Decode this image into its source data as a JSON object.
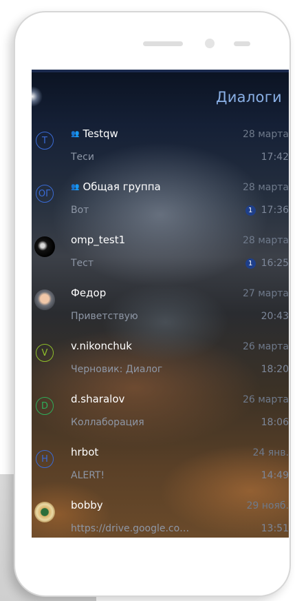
{
  "header": {
    "title": "Диалоги"
  },
  "colors": {
    "accent": "#8ab0e6",
    "badge": "#1e3f8a"
  },
  "dialogs": [
    {
      "initials": "T",
      "ring": "#3a6bd6",
      "avatar_kind": "initials",
      "group": true,
      "name": "Testqw",
      "preview": "Теси",
      "date": "28 марта",
      "time": "17:42",
      "unread": ""
    },
    {
      "initials": "ОГ",
      "ring": "#3a6bd6",
      "avatar_kind": "initials",
      "group": true,
      "name": "Общая группа",
      "preview": "Вот",
      "date": "28 марта",
      "time": "17:36",
      "unread": "1"
    },
    {
      "initials": "",
      "ring": "",
      "avatar_kind": "photo-omp",
      "group": false,
      "name": "omp_test1",
      "preview": "Тест",
      "date": "28 марта",
      "time": "16:25",
      "unread": "1"
    },
    {
      "initials": "",
      "ring": "",
      "avatar_kind": "photo-fedor",
      "group": false,
      "name": "Федор",
      "preview": "Приветствую",
      "date": "27 марта",
      "time": "20:43",
      "unread": ""
    },
    {
      "initials": "V",
      "ring": "#8fbf2a",
      "avatar_kind": "initials",
      "group": false,
      "name": "v.nikonchuk",
      "preview": "Черновик: Диалог",
      "date": "26 марта",
      "time": "18:20",
      "unread": ""
    },
    {
      "initials": "D",
      "ring": "#2fae5a",
      "avatar_kind": "initials",
      "group": false,
      "name": "d.sharalov",
      "preview": "Коллаборация",
      "date": "26 марта",
      "time": "18:06",
      "unread": ""
    },
    {
      "initials": "H",
      "ring": "#3a6bd6",
      "avatar_kind": "initials",
      "group": false,
      "name": "hrbot",
      "preview": "ALERT!",
      "date": "24 янв.",
      "time": "14:49",
      "unread": ""
    },
    {
      "initials": "",
      "ring": "",
      "avatar_kind": "photo-bobby",
      "group": false,
      "name": "bobby",
      "preview": "https://drive.google.co…",
      "date": "29 нояб.",
      "time": "13:51",
      "unread": ""
    }
  ]
}
